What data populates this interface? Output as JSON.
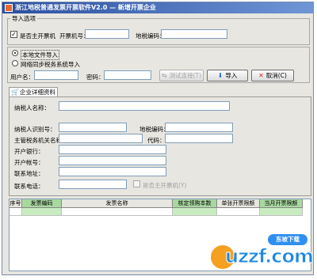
{
  "window": {
    "title": "浙江地税普通发票开票软件V2.0 — 新增开票企业"
  },
  "import_options": {
    "group_title": "导入选项",
    "is_main_invoicer_label": "是否主开票机",
    "is_main_invoicer_checked": true,
    "invoicer_no_label": "开票机号：",
    "invoicer_no_value": "",
    "region_code_label": "地税编码：",
    "region_code_value": ""
  },
  "import_source": {
    "local_file_label": "本地文件导入",
    "network_label": "网络同步税务系统导入",
    "selected": "local_file",
    "username_label": "用户名：",
    "username_value": "",
    "password_label": "密码：",
    "password_value": "",
    "test_connection_label": "测试连接(T)",
    "import_label": "导入",
    "cancel_label": "取消(C)"
  },
  "tab": {
    "label": "企业详细资料"
  },
  "company": {
    "taxpayer_name_label": "纳税人名称：",
    "taxpayer_name_value": "",
    "taxpayer_id_label": "纳税人识别号：",
    "taxpayer_id_value": "",
    "region_code_label": "地税编码：",
    "region_code_value": "",
    "tax_authority_label": "主管税务机关名称：",
    "tax_authority_value": "",
    "code_label": "代码：",
    "code_value": "",
    "bank_label": "开户银行：",
    "bank_value": "",
    "account_label": "开户帐号：",
    "account_value": "",
    "address_label": "联系地址：",
    "address_value": "",
    "phone_label": "联系电话：",
    "phone_value": "",
    "main_invoicer_disabled_label": "是否主开票机(Y)"
  },
  "grid": {
    "columns": [
      "序号",
      "发票编码",
      "发票名称",
      "核定领购本数",
      "单张开票限额",
      "当月开票限额"
    ],
    "rows": [
      [
        "",
        "",
        "",
        "",
        "",
        ""
      ]
    ]
  },
  "watermark": {
    "brand": "uzzf.com",
    "badge": "东坡下载"
  },
  "colors": {
    "title_start": "#2a4fa0",
    "title_end": "#6f96d6",
    "grid_header_green": "#a8d8a0",
    "grid_row_green": "#c8ecc0"
  }
}
